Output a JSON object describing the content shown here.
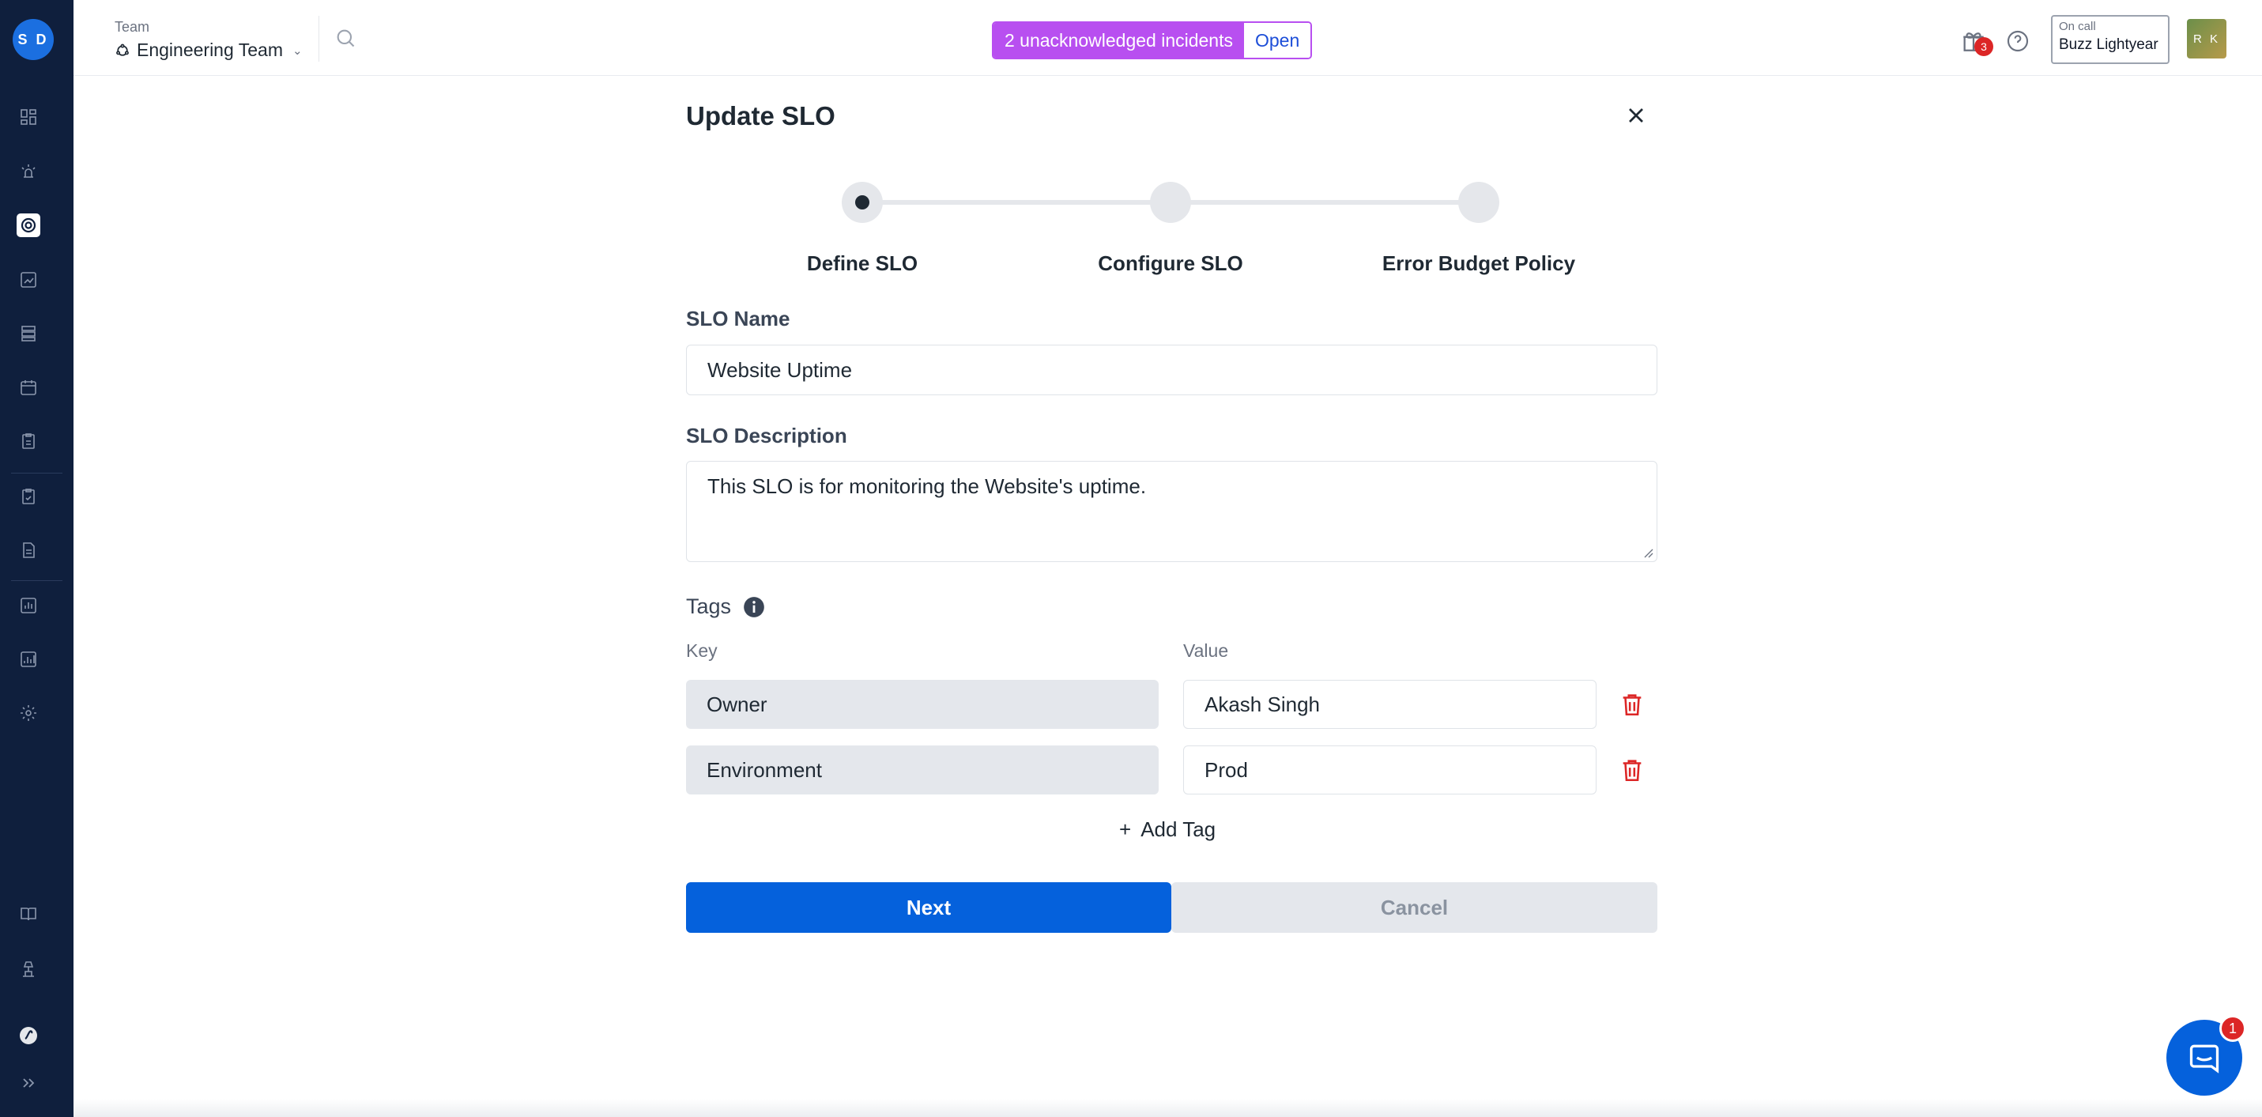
{
  "sidebar": {
    "avatar_initials": "S D",
    "icons": [
      "dashboard-icon",
      "incidents-icon",
      "slo-icon",
      "analytics-icon",
      "services-icon",
      "schedule-icon",
      "runbook-icon",
      "checklist-icon",
      "postmortem-icon",
      "reports-icon",
      "insights-icon",
      "settings-icon",
      "docs-icon",
      "integrations-icon",
      "brand-icon",
      "expand-icon"
    ]
  },
  "header": {
    "team_label": "Team",
    "team_name": "Engineering Team",
    "incident_banner": "2 unacknowledged incidents",
    "incident_action": "Open",
    "gift_badge_count": "3",
    "oncall_label": "On call",
    "oncall_name": "Buzz Lightyear",
    "user_initials": "R K"
  },
  "modal": {
    "title": "Update SLO",
    "steps": [
      {
        "label": "Define SLO",
        "active": true
      },
      {
        "label": "Configure SLO",
        "active": false
      },
      {
        "label": "Error Budget Policy",
        "active": false
      }
    ],
    "slo_name_label": "SLO Name",
    "slo_name_value": "Website Uptime",
    "slo_description_label": "SLO Description",
    "slo_description_value": "This SLO is for monitoring the Website's uptime.",
    "tags_label": "Tags",
    "key_col_label": "Key",
    "value_col_label": "Value",
    "tags": [
      {
        "key": "Owner",
        "value": "Akash Singh"
      },
      {
        "key": "Environment",
        "value": "Prod"
      }
    ],
    "add_tag_label": "Add Tag",
    "next_label": "Next",
    "cancel_label": "Cancel"
  },
  "chat": {
    "badge_count": "1"
  },
  "colors": {
    "sidebar_bg": "#0f1f3d",
    "primary": "#0561dc",
    "incident_purple": "#b84ff0",
    "danger": "#dc2626"
  }
}
